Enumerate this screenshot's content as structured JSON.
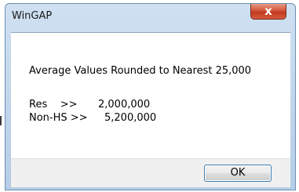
{
  "window": {
    "title": "WinGAP"
  },
  "titlebar": {
    "close_glyph": "x"
  },
  "message": {
    "heading": "Average Values Rounded to Nearest 25,000",
    "rows": [
      {
        "label": "Res    >>",
        "value": "2,000,000"
      },
      {
        "label": "Non-HS >>",
        "value": "5,200,000"
      }
    ]
  },
  "buttons": {
    "ok_label": "OK"
  },
  "icons": {
    "close": "close-icon"
  },
  "colors": {
    "close_button": "#c23a20",
    "frame": "#b5cde6",
    "ok_border": "#3c7fb1"
  }
}
